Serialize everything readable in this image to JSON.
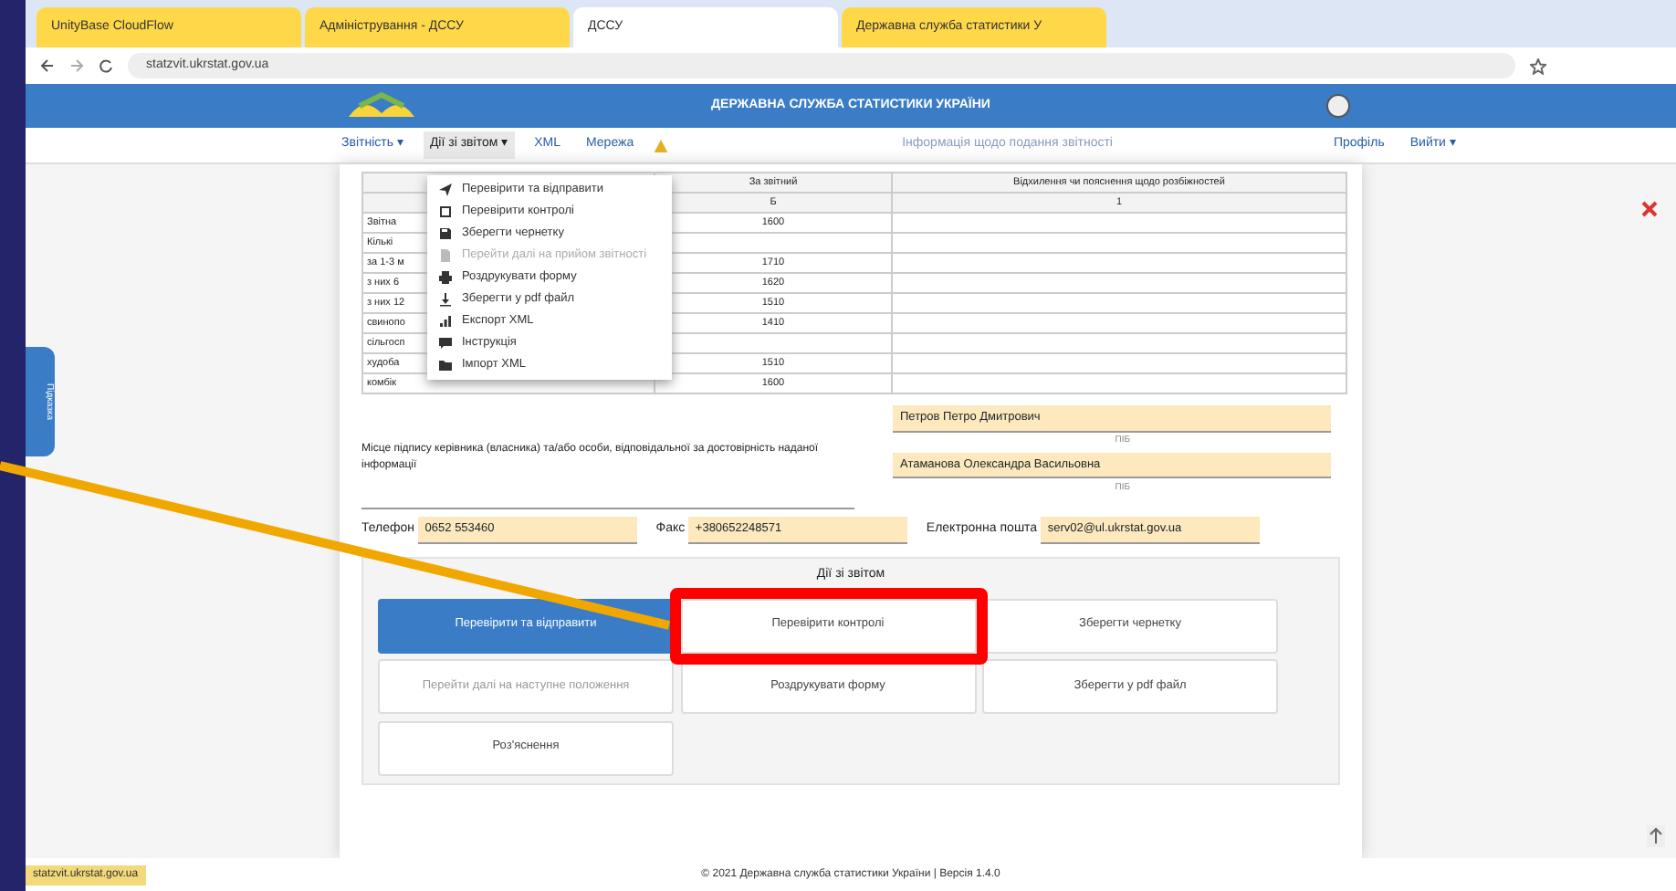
{
  "browser": {
    "tabs": [
      {
        "title": "UnityBase CloudFlow",
        "selected": false
      },
      {
        "title": "Адміністрування - ДССУ",
        "selected": false
      },
      {
        "title": "ДССУ",
        "selected": true
      },
      {
        "title": "Державна служба статистики У",
        "selected": false
      }
    ],
    "url": "statzvit.ukrstat.gov.ua"
  },
  "header": {
    "title": "ДЕРЖАВНА СЛУЖБА СТАТИСТИКИ УКРАЇНИ"
  },
  "nav": {
    "items": [
      {
        "label": "Звітність ▾",
        "selected": false
      },
      {
        "label": "Дії зі звітом ▾",
        "selected": true
      },
      {
        "label": "XML",
        "selected": false
      },
      {
        "label": "Мережа",
        "selected": false
      }
    ],
    "notice": "Інформація щодо подання звітності",
    "profile": "Профіль",
    "logout": "Вийти ▾"
  },
  "menu": {
    "items": [
      {
        "label": "Перевірити та відправити",
        "disabled": false
      },
      {
        "label": "Перевірити контролі",
        "disabled": false
      },
      {
        "label": "Зберегти чернетку",
        "disabled": false
      },
      {
        "label": "Перейти далі на прийом звітності",
        "disabled": true
      },
      {
        "label": "Роздрукувати форму",
        "disabled": false
      },
      {
        "label": "Зберегти у pdf файл",
        "disabled": false
      },
      {
        "label": "Експорт XML",
        "disabled": false
      },
      {
        "label": "Інструкція",
        "disabled": false
      },
      {
        "label": "Імпорт XML",
        "disabled": false
      }
    ]
  },
  "table": {
    "columns": [
      "За звітний",
      "Відхилення чи пояснення щодо розбіжностей"
    ],
    "codes": [
      "Б",
      "1"
    ],
    "rows": [
      {
        "label": "Звітна",
        "value": "1600"
      },
      {
        "label": "Кількі"
      },
      {
        "label": "за 1-3 м",
        "value": "1710"
      },
      {
        "label": "з них 6",
        "value": "1620"
      },
      {
        "label": "з них 12",
        "value": "1510"
      },
      {
        "label": "свинопо",
        "value": "1410"
      },
      {
        "label": "сільгосп"
      },
      {
        "label": "худоба",
        "value": "1510"
      },
      {
        "label": "комбік",
        "value": "1600"
      }
    ]
  },
  "signatures": {
    "note": "Місце підпису керівника (власника) та/або особи, відповідальної за достовірність наданої інформації",
    "people": [
      {
        "name": "Петров Петро Дмитрович",
        "caption": "ПІБ"
      },
      {
        "name": "Атаманова Олександра Васильовна",
        "caption": "ПІБ"
      }
    ]
  },
  "contacts": [
    {
      "label": "Телефон",
      "value": "0652 553460"
    },
    {
      "label": "Факс",
      "value": "+380652248571"
    },
    {
      "label": "Електронна пошта",
      "value": "serv02@ul.ukrstat.gov.ua"
    }
  ],
  "actions": {
    "title": "Дії зі звітом",
    "buttons": [
      {
        "label": "Перевірити та відправити",
        "kind": "primary"
      },
      {
        "label": "Перевірити контролі",
        "kind": "plain"
      },
      {
        "label": "Зберегти чернетку",
        "kind": "plain"
      },
      {
        "label": "Перейти далі на наступне положення",
        "kind": "muted"
      },
      {
        "label": "Роздрукувати форму",
        "kind": "plain"
      },
      {
        "label": "Зберегти у pdf файл",
        "kind": "plain"
      },
      {
        "label": "Роз'яснення",
        "kind": "plain"
      }
    ]
  },
  "side_tab": "Підказка",
  "footer": "© 2021 Державна служба статистики України | Версія 1.4.0",
  "status_tip": "statzvit.ukrstat.gov.ua"
}
